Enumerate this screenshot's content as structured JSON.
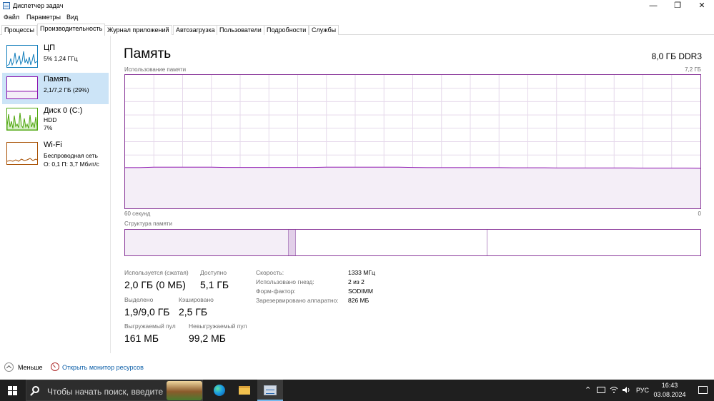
{
  "window": {
    "title": "Диспетчер задач",
    "minimize_glyph": "—",
    "restore_glyph": "❐",
    "close_glyph": "✕"
  },
  "menu": [
    "Файл",
    "Параметры",
    "Вид"
  ],
  "tabs": [
    {
      "label": "Процессы",
      "active": false
    },
    {
      "label": "Производительность",
      "active": true
    },
    {
      "label": "Журнал приложений",
      "active": false
    },
    {
      "label": "Автозагрузка",
      "active": false
    },
    {
      "label": "Пользователи",
      "active": false
    },
    {
      "label": "Подробности",
      "active": false
    },
    {
      "label": "Службы",
      "active": false
    }
  ],
  "sidebar": {
    "items": [
      {
        "name": "ЦП",
        "lines": [
          "5% 1,24 ГГц"
        ],
        "color": "#117dbb",
        "icon": "cpu-graph-icon"
      },
      {
        "name": "Память",
        "lines": [
          "2,1/7,2 ГБ (29%)"
        ],
        "color": "#8b12ae",
        "icon": "memory-graph-icon",
        "active": true
      },
      {
        "name": "Диск 0 (C:)",
        "lines": [
          "HDD",
          "7%"
        ],
        "color": "#4da60c",
        "icon": "disk-graph-icon"
      },
      {
        "name": "Wi-Fi",
        "lines": [
          "Беспроводная сеть",
          "О: 0,1 П: 3,7 Мбит/с"
        ],
        "color": "#a74f01",
        "icon": "wifi-graph-icon"
      }
    ]
  },
  "main": {
    "title": "Память",
    "spec": "8,0 ГБ DDR3",
    "usage_label": "Использование памяти",
    "usage_max": "7,2 ГБ",
    "time_left": "60 секунд",
    "time_right": "0",
    "composition_label": "Структура памяти"
  },
  "usage_graph": {
    "ymax_gb": 7.2,
    "samples_gb": [
      2.2,
      2.2,
      2.22,
      2.22,
      2.22,
      2.22,
      2.22,
      2.21,
      2.21,
      2.21,
      2.21,
      2.21,
      2.21,
      2.21,
      2.22,
      2.22,
      2.22,
      2.22,
      2.22,
      2.22,
      2.21,
      2.2,
      2.2,
      2.2,
      2.2,
      2.2,
      2.2,
      2.19,
      2.19,
      2.19,
      2.18,
      2.18,
      2.18,
      2.18,
      2.18,
      2.18,
      2.17,
      2.17,
      2.17,
      2.17,
      2.16
    ],
    "line_color": "#8b12ae",
    "fill_color": "#f4eef7",
    "grid_color": "#e6d9eb"
  },
  "composition": {
    "in_use_fraction": 0.285,
    "modified_fraction": 0.012,
    "standby_end_fraction": 0.63,
    "in_use_color": "#f4eef7",
    "modified_color": "#e2cfe9"
  },
  "stats": [
    {
      "label": "Используется (сжатая)",
      "value": "2,0 ГБ (0 МБ)"
    },
    {
      "label": "Доступно",
      "value": "5,1 ГБ"
    },
    {
      "label": "Выделено",
      "value": "1,9/9,0 ГБ"
    },
    {
      "label": "Кэшировано",
      "value": "2,5 ГБ"
    },
    {
      "label": "Выгружаемый пул",
      "value": "161 МБ"
    },
    {
      "label": "Невыгружаемый пул",
      "value": "99,2 МБ"
    }
  ],
  "properties": [
    {
      "label": "Скорость:",
      "value": "1333 МГц"
    },
    {
      "label": "Использовано гнезд:",
      "value": "2 из 2"
    },
    {
      "label": "Форм-фактор:",
      "value": "SODIMM"
    },
    {
      "label": "Зарезервировано аппаратно:",
      "value": "826 МБ"
    }
  ],
  "footer": {
    "fewer_details": "Меньше",
    "resource_monitor": "Открыть монитор ресурсов"
  },
  "taskbar": {
    "search_placeholder": "Чтобы начать поиск, введите",
    "tray_chevron": "⌃",
    "language": "РУС",
    "time": "16:43",
    "date": "03.08.2024"
  }
}
